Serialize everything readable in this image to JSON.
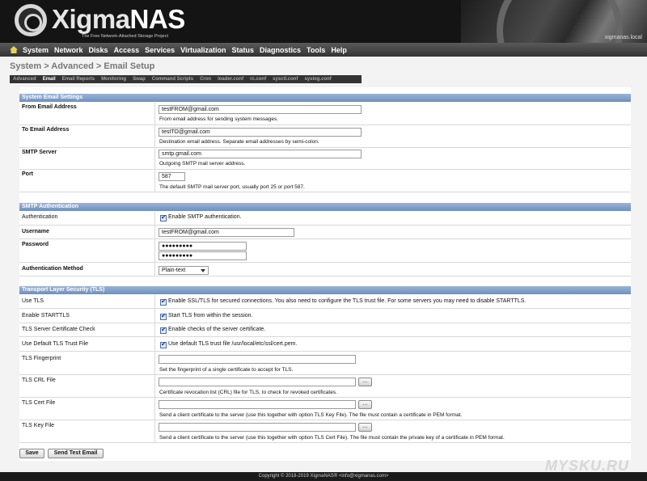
{
  "header": {
    "brand_prefix": "Xigma",
    "brand_suffix": "NAS",
    "tagline": "The Free Network-Attached Storage Project",
    "hostname": "xigmanas.local"
  },
  "nav": {
    "items": [
      "System",
      "Network",
      "Disks",
      "Access",
      "Services",
      "Virtualization",
      "Status",
      "Diagnostics",
      "Tools",
      "Help"
    ]
  },
  "breadcrumb": "System > Advanced > Email Setup",
  "tabs": [
    "Advanced",
    "Email",
    "Email Reports",
    "Monitoring",
    "Swap",
    "Command Scripts",
    "Cron",
    "loader.conf",
    "rc.conf",
    "sysctl.conf",
    "syslog.conf"
  ],
  "sections": {
    "email": "System Email Settings",
    "smtp_auth": "SMTP Authentication",
    "tls": "Transport Layer Security (TLS)"
  },
  "fields": {
    "from_label": "From Email Address",
    "from_value": "testFROM@gmail.com",
    "from_help": "From email address for sending system messages.",
    "to_label": "To Email Address",
    "to_value": "testTO@gmail.com",
    "to_help": "Destination email address. Separate email addresses by semi-colon.",
    "smtp_label": "SMTP Server",
    "smtp_value": "smtp.gmail.com",
    "smtp_help": "Outgoing SMTP mail server address.",
    "port_label": "Port",
    "port_value": "587",
    "port_help": "The default SMTP mail server port, usually port 25 or port 587.",
    "auth_label": "Authentication",
    "auth_check": "Enable SMTP authentication.",
    "username_label": "Username",
    "username_value": "testFROM@gmail.com",
    "password_label": "Password",
    "password_value": "●●●●●●●●●",
    "password_confirm": "●●●●●●●●●",
    "auth_method_label": "Authentication Method",
    "auth_method_value": "Plain-text",
    "use_tls_label": "Use TLS",
    "use_tls_check": "Enable SSL/TLS for secured connections. You also need to configure the TLS trust file. For some servers you may need to disable STARTTLS.",
    "starttls_label": "Enable STARTTLS",
    "starttls_check": "Start TLS from within the session.",
    "certcheck_label": "TLS Server Certificate Check",
    "certcheck_check": "Enable checks of the server certificate.",
    "trustfile_label": "Use Default TLS Trust File",
    "trustfile_check": "Use default TLS trust file /usr/local/etc/ssl/cert.pem.",
    "fingerprint_label": "TLS Fingerprint",
    "fingerprint_help": "Set the fingerprint of a single certificate to accept for TLS.",
    "crl_label": "TLS CRL File",
    "crl_help": "Certificate revocation list (CRL) file for TLS, to check for revoked certificates.",
    "cert_label": "TLS Cert File",
    "cert_help": "Send a client certificate to the server (use this together with option TLS Key File). The file must contain a certificate in PEM format.",
    "key_label": "TLS Key File",
    "key_help": "Send a client certificate to the server (use this together with option TLS Cert File). The file must contain the private key of a certificate in PEM format.",
    "browse": "..."
  },
  "buttons": {
    "save": "Save",
    "test": "Send Test Email"
  },
  "footer": "Copyright © 2018-2019 XigmaNAS® <info@xigmanas.com>",
  "watermark": "MYSKU.RU"
}
